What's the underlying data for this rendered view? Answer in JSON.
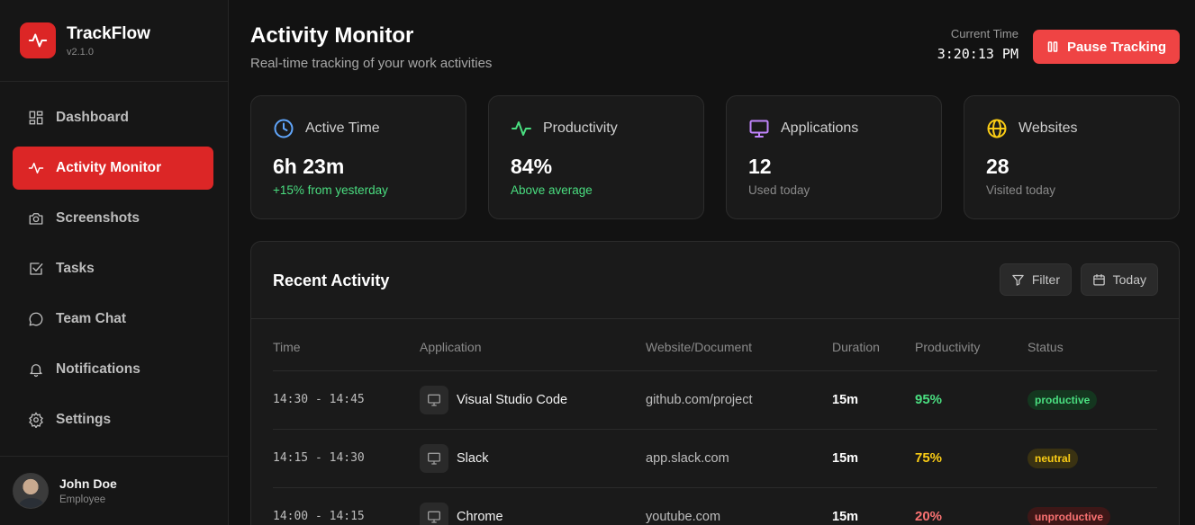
{
  "brand": {
    "name": "TrackFlow",
    "version": "v2.1.0"
  },
  "sidebar": {
    "items": [
      {
        "label": "Dashboard",
        "icon": "grid-icon",
        "active": false
      },
      {
        "label": "Activity Monitor",
        "icon": "activity-icon",
        "active": true
      },
      {
        "label": "Screenshots",
        "icon": "camera-icon",
        "active": false
      },
      {
        "label": "Tasks",
        "icon": "checkbox-icon",
        "active": false
      },
      {
        "label": "Team Chat",
        "icon": "chat-icon",
        "active": false
      },
      {
        "label": "Notifications",
        "icon": "bell-icon",
        "active": false
      },
      {
        "label": "Settings",
        "icon": "gear-icon",
        "active": false
      }
    ],
    "user": {
      "name": "John Doe",
      "role": "Employee"
    }
  },
  "header": {
    "title": "Activity Monitor",
    "subtitle": "Real-time tracking of your work activities",
    "clock_label": "Current Time",
    "clock_value": "3:20:13 PM",
    "pause_label": "Pause Tracking"
  },
  "stats": [
    {
      "label": "Active Time",
      "value": "6h 23m",
      "note": "+15% from yesterday",
      "icon": "clock-icon",
      "color": "#60a5fa",
      "note_color": "#4ade80"
    },
    {
      "label": "Productivity",
      "value": "84%",
      "note": "Above average",
      "icon": "activity-icon",
      "color": "#4ade80",
      "note_color": "#4ade80"
    },
    {
      "label": "Applications",
      "value": "12",
      "note": "Used today",
      "icon": "monitor-icon",
      "color": "#c084fc",
      "note_color": "#8a8a8a"
    },
    {
      "label": "Websites",
      "value": "28",
      "note": "Visited today",
      "icon": "globe-icon",
      "color": "#facc15",
      "note_color": "#8a8a8a"
    }
  ],
  "activity": {
    "title": "Recent Activity",
    "filter_label": "Filter",
    "date_label": "Today",
    "columns": [
      "Time",
      "Application",
      "Website/Document",
      "Duration",
      "Productivity",
      "Status"
    ],
    "rows": [
      {
        "time": "14:30 - 14:45",
        "app": "Visual Studio Code",
        "site": "github.com/project",
        "duration": "15m",
        "productivity": "95%",
        "status": "productive",
        "prod_color": "#4ade80",
        "badge_bg": "#14361f",
        "badge_color": "#4ade80"
      },
      {
        "time": "14:15 - 14:30",
        "app": "Slack",
        "site": "app.slack.com",
        "duration": "15m",
        "productivity": "75%",
        "status": "neutral",
        "prod_color": "#facc15",
        "badge_bg": "#3a3212",
        "badge_color": "#facc15"
      },
      {
        "time": "14:00 - 14:15",
        "app": "Chrome",
        "site": "youtube.com",
        "duration": "15m",
        "productivity": "20%",
        "status": "unproductive",
        "prod_color": "#f87171",
        "badge_bg": "#3d1717",
        "badge_color": "#f87171"
      }
    ]
  },
  "colors": {
    "accent": "#dc2626",
    "pause_button": "#ef4444",
    "background": "#121212"
  }
}
